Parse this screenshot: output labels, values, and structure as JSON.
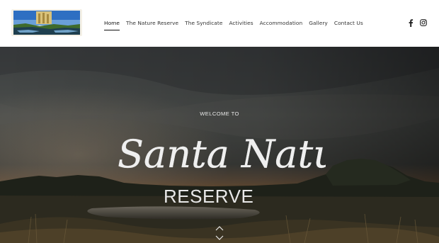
{
  "header": {
    "logo_icon": "reserve-landscape-logo",
    "nav": [
      {
        "label": "Home",
        "active": true
      },
      {
        "label": "The Nature Reserve",
        "active": false
      },
      {
        "label": "The Syndicate",
        "active": false
      },
      {
        "label": "Activities",
        "active": false
      },
      {
        "label": "Accommodation",
        "active": false
      },
      {
        "label": "Gallery",
        "active": false
      },
      {
        "label": "Contact Us",
        "active": false
      }
    ],
    "social": [
      "facebook-icon",
      "instagram-icon"
    ]
  },
  "hero": {
    "welcome": "WELCOME TO",
    "title_script": "Santa Nature",
    "title_sub": "RESERVE",
    "scroll_icon": "chevron-up-down-icon"
  },
  "colors": {
    "nav_text": "#333333",
    "hero_text": "#e8e8e8"
  }
}
